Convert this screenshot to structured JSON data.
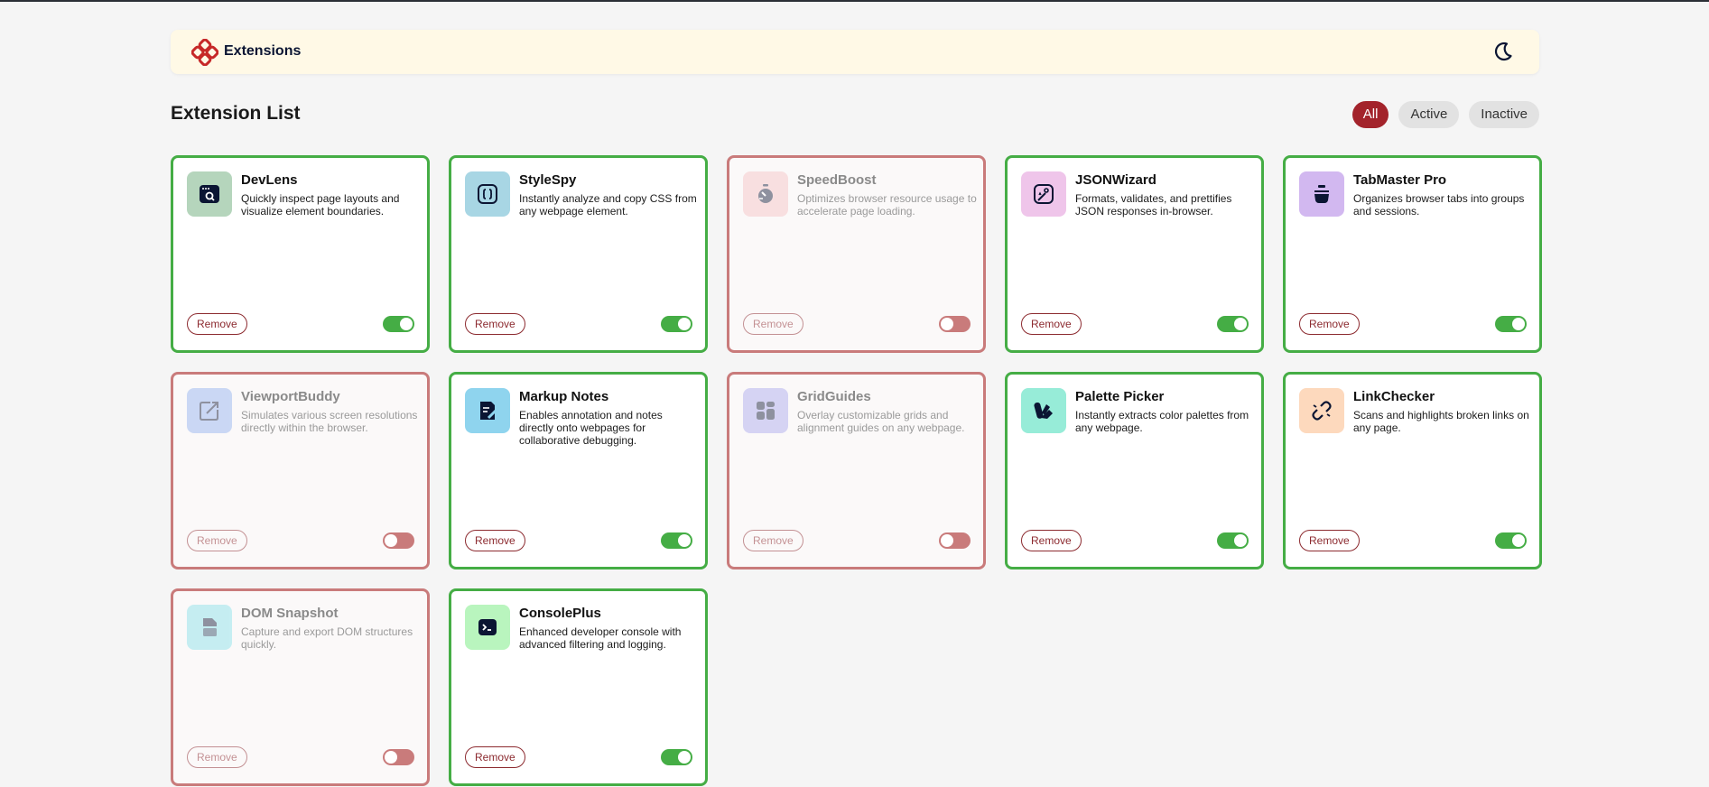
{
  "header": {
    "brand": "Extensions",
    "logo_icon": "extensions-logo-icon",
    "theme_icon": "moon-icon",
    "brand_color": "#c62828"
  },
  "list": {
    "title": "Extension List",
    "filters": [
      {
        "label": "All",
        "active": true
      },
      {
        "label": "Active",
        "active": false
      },
      {
        "label": "Inactive",
        "active": false
      }
    ]
  },
  "colors": {
    "active_border": "#45ad45",
    "inactive_border": "#c97b7b",
    "accent": "#a3232b"
  },
  "extensions": [
    {
      "name": "DevLens",
      "desc": "Quickly inspect page layouts and visualize element boundaries.",
      "enabled": true,
      "remove_label": "Remove",
      "icon": "browser-search-icon",
      "icon_bg": "#b5d5bc"
    },
    {
      "name": "StyleSpy",
      "desc": "Instantly analyze and copy CSS from any webpage element.",
      "enabled": true,
      "remove_label": "Remove",
      "icon": "css-braces-icon",
      "icon_bg": "#a8d6e4"
    },
    {
      "name": "SpeedBoost",
      "desc": "Optimizes browser resource usage to accelerate page loading.",
      "enabled": false,
      "remove_label": "Remove",
      "icon": "stopwatch-icon",
      "icon_bg": "#f6c0c3"
    },
    {
      "name": "JSONWizard",
      "desc": "Formats, validates, and prettifies JSON responses in-browser.",
      "enabled": true,
      "remove_label": "Remove",
      "icon": "json-wand-icon",
      "icon_bg": "#efc5ea"
    },
    {
      "name": "TabMaster Pro",
      "desc": "Organizes browser tabs into groups and sessions.",
      "enabled": true,
      "remove_label": "Remove",
      "icon": "tab-stack-icon",
      "icon_bg": "#d2b8f0"
    },
    {
      "name": "ViewportBuddy",
      "desc": "Simulates various screen resolutions directly within the browser.",
      "enabled": false,
      "remove_label": "Remove",
      "icon": "expand-arrow-icon",
      "icon_bg": "#8fb0ee"
    },
    {
      "name": "Markup Notes",
      "desc": "Enables annotation and notes directly onto webpages for collaborative debugging.",
      "enabled": true,
      "remove_label": "Remove",
      "icon": "note-pen-icon",
      "icon_bg": "#8fd4ee"
    },
    {
      "name": "GridGuides",
      "desc": "Overlay customizable grids and alignment guides on any webpage.",
      "enabled": false,
      "remove_label": "Remove",
      "icon": "grid-layout-icon",
      "icon_bg": "#a9a6ec"
    },
    {
      "name": "Palette Picker",
      "desc": "Instantly extracts color palettes from any webpage.",
      "enabled": true,
      "remove_label": "Remove",
      "icon": "palette-icon",
      "icon_bg": "#97ecd8"
    },
    {
      "name": "LinkChecker",
      "desc": "Scans and highlights broken links on any page.",
      "enabled": true,
      "remove_label": "Remove",
      "icon": "broken-link-icon",
      "icon_bg": "#fdd9bd"
    },
    {
      "name": "DOM Snapshot",
      "desc": "Capture and export DOM structures quickly.",
      "enabled": false,
      "remove_label": "Remove",
      "icon": "document-snapshot-icon",
      "icon_bg": "#84dfe9"
    },
    {
      "name": "ConsolePlus",
      "desc": "Enhanced developer console with advanced filtering and logging.",
      "enabled": true,
      "remove_label": "Remove",
      "icon": "terminal-icon",
      "icon_bg": "#b9f5be"
    }
  ]
}
